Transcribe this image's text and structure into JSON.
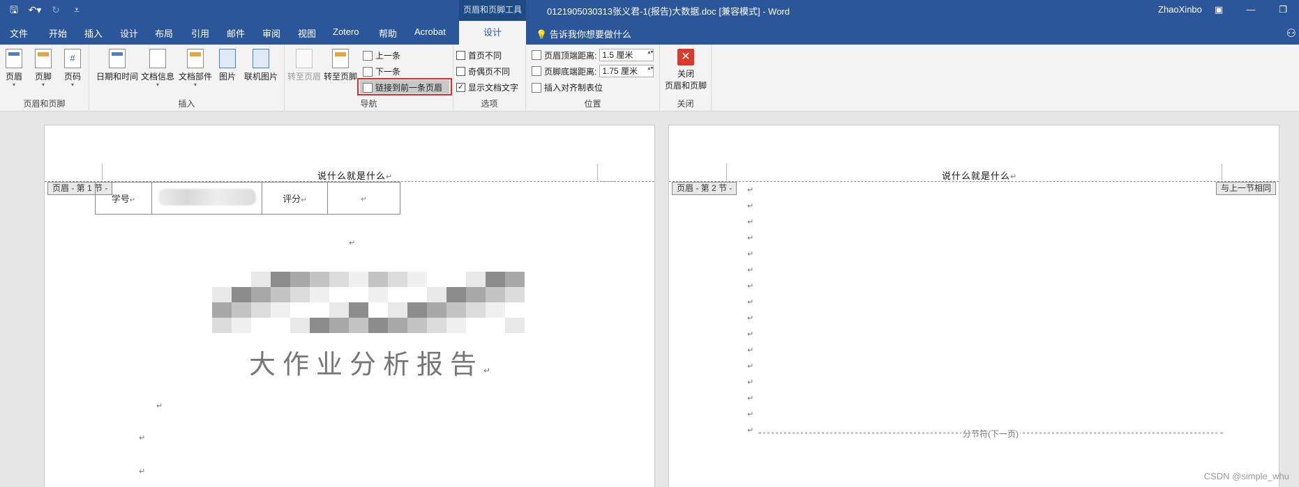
{
  "title_bar": {
    "contextual_tab_group": "页眉和页脚工具",
    "document_title": "0121905030313张义君-1(报告)大数据.doc [兼容模式]  -  Word",
    "user": "ZhaoXinbo"
  },
  "tabs": [
    "文件",
    "开始",
    "插入",
    "设计",
    "布局",
    "引用",
    "邮件",
    "审阅",
    "视图",
    "Zotero",
    "帮助",
    "Acrobat",
    "设计"
  ],
  "tell_me": "告诉我你想要做什么",
  "ribbon": {
    "group_header_footer": {
      "label": "页眉和页脚",
      "buttons": [
        "页眉",
        "页脚",
        "页码"
      ]
    },
    "group_insert": {
      "label": "插入",
      "buttons": [
        "日期和时间",
        "文档信息",
        "文档部件",
        "图片",
        "联机图片"
      ]
    },
    "group_nav": {
      "label": "导航",
      "goto_header": "转至页眉",
      "goto_footer": "转至页脚",
      "prev": "上一条",
      "next": "下一条",
      "link_to_previous": "链接到前一条页眉"
    },
    "group_options": {
      "label": "选项",
      "first_page": "首页不同",
      "odd_even": "奇偶页不同",
      "show_text": "显示文档文字"
    },
    "group_position": {
      "label": "位置",
      "header_top_label": "页眉顶端距离:",
      "header_top_value": "1.5 厘米",
      "footer_bottom_label": "页脚底端距离:",
      "footer_bottom_value": "1.75 厘米",
      "insert_align_tab": "插入对齐制表位"
    },
    "group_close": {
      "label": "关闭",
      "close_button_line1": "关闭",
      "close_button_line2": "页眉和页脚"
    }
  },
  "page1": {
    "header_text": "说什么就是什么",
    "section_tag": "页眉 - 第 1 节 -",
    "table_label_id": "学号",
    "table_label_score": "评分",
    "doc_title": "大作业分析报告"
  },
  "page2": {
    "header_text": "说什么就是什么",
    "section_tag": "页眉 - 第 2 节 -",
    "same_as_previous": "与上一节相同",
    "section_break": "分节符(下一页)"
  },
  "paragraph_mark": "↵",
  "watermark": "CSDN @simple_whu",
  "colors": {
    "title_bar": "#2b579a",
    "ribbon": "#f3f3f3",
    "highlight": "#e02b2b"
  }
}
